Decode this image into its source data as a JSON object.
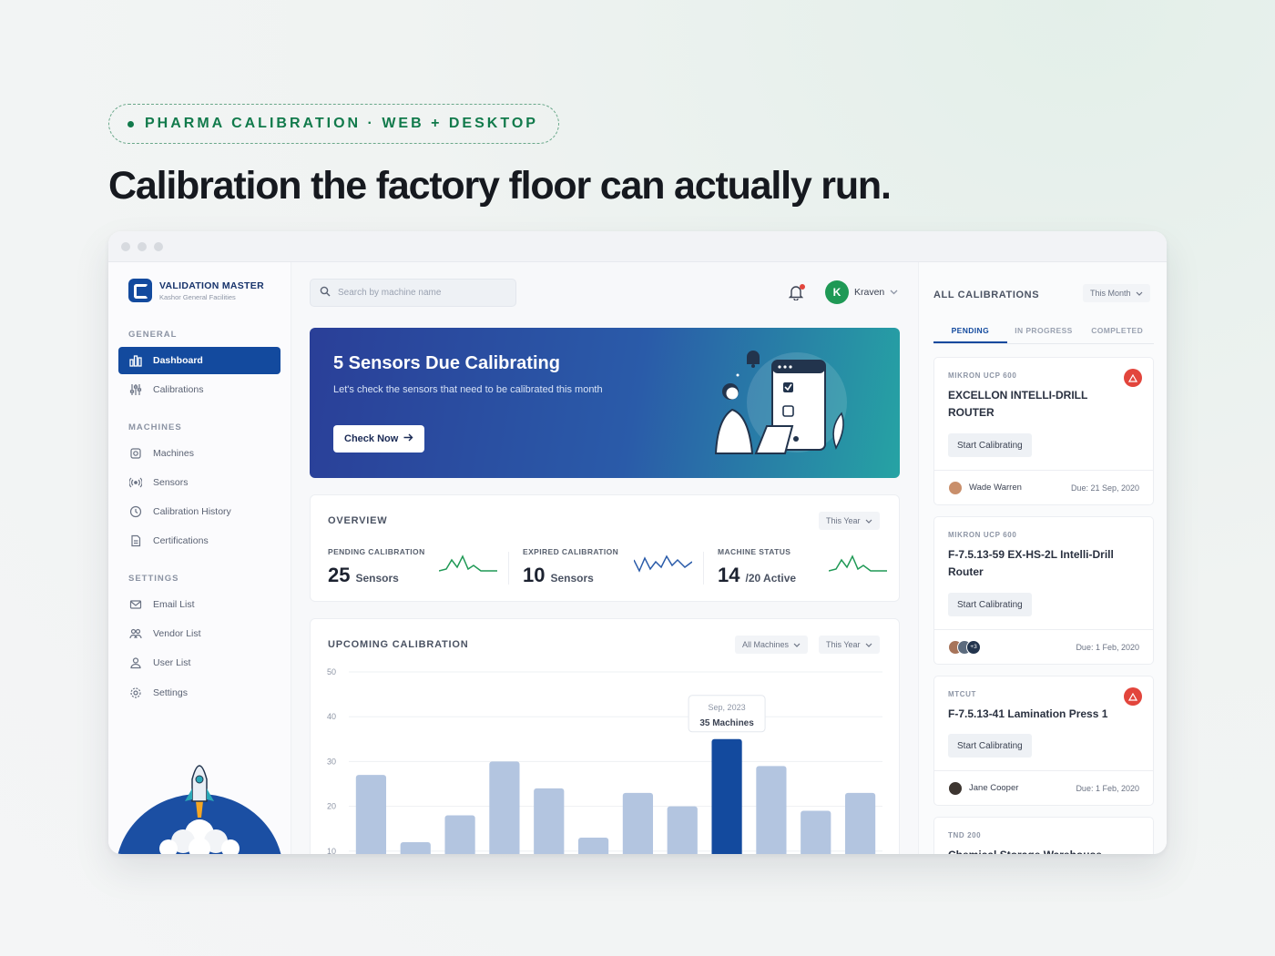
{
  "tagline": "PHARMA CALIBRATION · WEB + DESKTOP",
  "headline": "Calibration the factory floor can actually run.",
  "brand": {
    "name": "VALIDATION MASTER",
    "subtitle": "Kashor General Facilities"
  },
  "sidebar": {
    "sections": [
      {
        "label": "GENERAL"
      },
      {
        "label": "MACHINES"
      },
      {
        "label": "SETTINGS"
      }
    ],
    "items": [
      {
        "label": "Dashboard",
        "icon": "dashboard-icon"
      },
      {
        "label": "Calibrations",
        "icon": "sliders-icon"
      },
      {
        "label": "Machines",
        "icon": "cog-icon"
      },
      {
        "label": "Sensors",
        "icon": "signal-icon"
      },
      {
        "label": "Calibration History",
        "icon": "clock-icon"
      },
      {
        "label": "Certifications",
        "icon": "document-icon"
      },
      {
        "label": "Email List",
        "icon": "mail-icon"
      },
      {
        "label": "Vendor List",
        "icon": "vendors-icon"
      },
      {
        "label": "User List",
        "icon": "users-icon"
      },
      {
        "label": "Settings",
        "icon": "gear-icon"
      }
    ]
  },
  "header": {
    "search_placeholder": "Search by machine name",
    "user_initial": "K",
    "user_name": "Kraven"
  },
  "banner": {
    "title": "5 Sensors Due Calibrating",
    "description": "Let's check the sensors that need to be calibrated this month",
    "button": "Check Now"
  },
  "overview": {
    "title": "OVERVIEW",
    "filter": "This Year",
    "stats": [
      {
        "label": "PENDING CALIBRATION",
        "value": "25",
        "unit": "Sensors"
      },
      {
        "label": "EXPIRED CALIBRATION",
        "value": "10",
        "unit": "Sensors"
      },
      {
        "label": "MACHINE STATUS",
        "value": "14",
        "unit": "/20 Active"
      }
    ]
  },
  "upcoming": {
    "title": "UPCOMING CALIBRATION",
    "filter_machines": "All Machines",
    "filter_period": "This Year"
  },
  "chart_data": {
    "type": "bar",
    "title": "UPCOMING CALIBRATION",
    "ylim": [
      0,
      50
    ],
    "yticks": [
      10,
      20,
      30,
      40,
      50
    ],
    "values": [
      27,
      12,
      18,
      30,
      24,
      13,
      23,
      20,
      35,
      29,
      19,
      23
    ],
    "highlight_index": 8,
    "tooltip": {
      "date": "Sep, 2023",
      "label": "35 Machines"
    },
    "grid": true,
    "colors": {
      "bar": "#b3c5e0",
      "highlight": "#134a9e"
    }
  },
  "right_panel": {
    "title": "ALL CALIBRATIONS",
    "filter": "This Month",
    "tabs": [
      "PENDING",
      "IN PROGRESS",
      "COMPLETED"
    ],
    "cards": [
      {
        "model": "MIKRON UCP 600",
        "name": "EXCELLON INTELLI-DRILL ROUTER",
        "action": "Start Calibrating",
        "assignee": "Wade Warren",
        "due": "Due: 21 Sep, 2020"
      },
      {
        "model": "MIKRON UCP 600",
        "name": "F-7.5.13-59 EX-HS-2L Intelli-Drill Router",
        "action": "Start Calibrating",
        "extra_count": "+3",
        "due": "Due: 1 Feb, 2020"
      },
      {
        "model": "MTCUT",
        "name": "F-7.5.13-41 Lamination Press 1",
        "action": "Start Calibrating",
        "assignee": "Jane Cooper",
        "due": "Due: 1 Feb, 2020"
      },
      {
        "model": "TND 200",
        "name": "Chemical Storage Warehouse"
      }
    ]
  }
}
